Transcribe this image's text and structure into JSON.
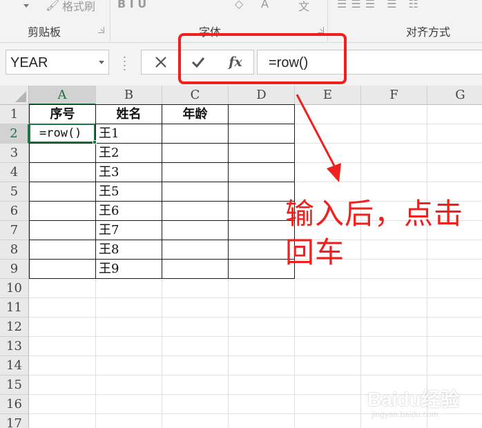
{
  "ribbon": {
    "format_painter_label": "格式刷",
    "font_buttons_faint": "B  I  U",
    "clipboard_group": "剪贴板",
    "font_group": "字体",
    "alignment_group": "对齐方式"
  },
  "formula_bar": {
    "name_box": "YEAR",
    "cancel_icon": "✕",
    "enter_icon": "✔",
    "fx_label": "fx",
    "formula": "=row()"
  },
  "sheet": {
    "columns": [
      "A",
      "B",
      "C",
      "D",
      "E",
      "F",
      "G"
    ],
    "rows": [
      "1",
      "2",
      "3",
      "4",
      "5",
      "6",
      "7",
      "8",
      "9",
      "10",
      "11",
      "12",
      "13",
      "14",
      "15",
      "16",
      "17"
    ],
    "selected_column": "A",
    "selected_row": "2",
    "header": {
      "a1": "序号",
      "b1": "姓名",
      "c1": "年龄"
    },
    "names": [
      "王1",
      "王2",
      "王3",
      "王5",
      "王6",
      "王7",
      "王8",
      "王9"
    ],
    "active_cell_value": "=row()"
  },
  "annotation": {
    "text": "输入后，点击回车",
    "color": "#f0201f"
  },
  "watermark": {
    "brand": "Baidu经验",
    "url": "jingyan.baidu.com"
  },
  "colors": {
    "excel_green": "#217346",
    "annotation_red": "#f0201f"
  }
}
